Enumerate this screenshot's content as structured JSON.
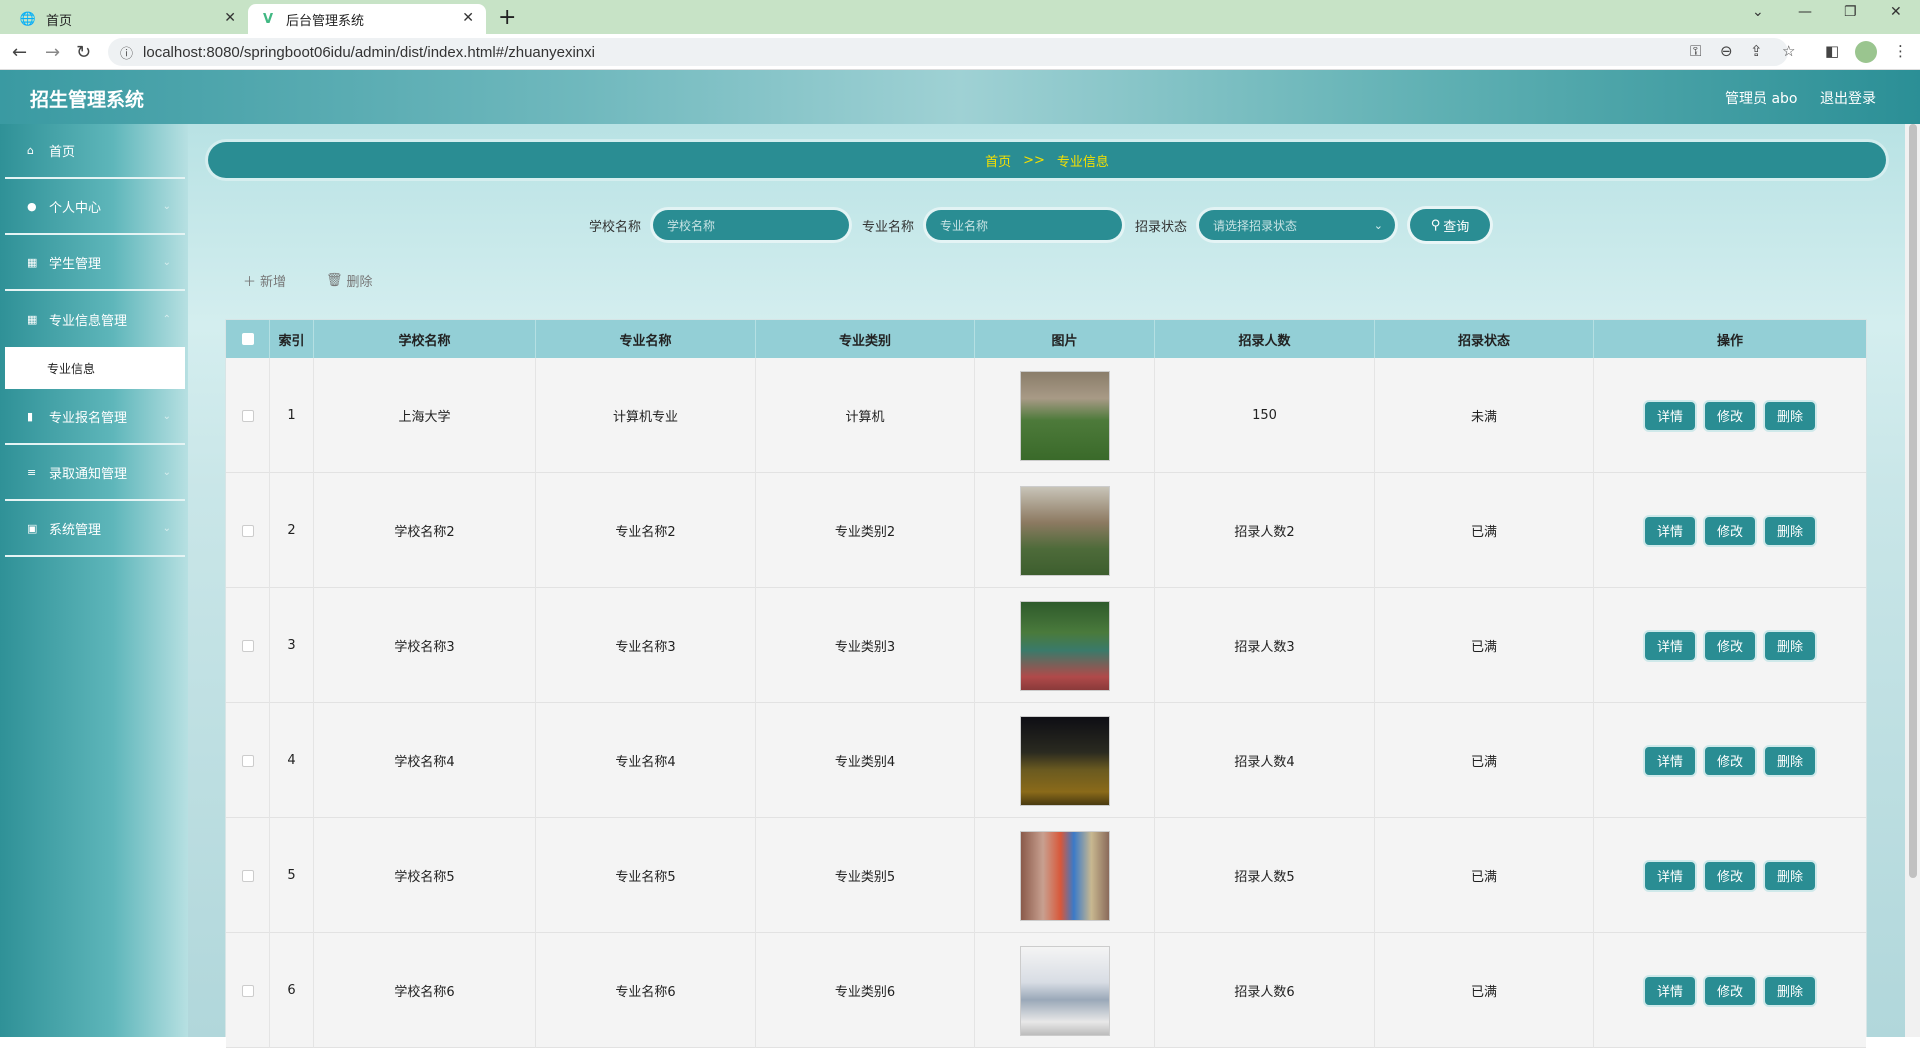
{
  "browser": {
    "tabs": [
      {
        "title": "首页",
        "icon": "globe-icon"
      },
      {
        "title": "后台管理系统",
        "icon": "vue-logo-icon"
      }
    ],
    "url": "localhost:8080/springboot06idu/admin/dist/index.html#/zhuanyexinxi"
  },
  "header": {
    "title": "招生管理系统",
    "user": "管理员 abo",
    "logout": "退出登录"
  },
  "sidebar": {
    "items": [
      {
        "label": "首页",
        "icon": "home-icon"
      },
      {
        "label": "个人中心",
        "icon": "user-icon"
      },
      {
        "label": "学生管理",
        "icon": "grid-icon"
      },
      {
        "label": "专业信息管理",
        "icon": "grid-icon"
      },
      {
        "label": "专业报名管理",
        "icon": "chart-icon"
      },
      {
        "label": "录取通知管理",
        "icon": "list-icon"
      },
      {
        "label": "系统管理",
        "icon": "briefcase-icon"
      }
    ],
    "active_sub": "专业信息"
  },
  "breadcrumb": {
    "home": "首页",
    "sep": ">>",
    "current": "专业信息"
  },
  "search": {
    "school_label": "学校名称",
    "school_placeholder": "学校名称",
    "major_label": "专业名称",
    "major_placeholder": "专业名称",
    "status_label": "招录状态",
    "status_placeholder": "请选择招录状态",
    "query_button": "查询"
  },
  "actions": {
    "add": "新增",
    "delete": "删除"
  },
  "table": {
    "columns": [
      "索引",
      "学校名称",
      "专业名称",
      "专业类别",
      "图片",
      "招录人数",
      "招录状态",
      "操作"
    ],
    "row_buttons": {
      "detail": "详情",
      "edit": "修改",
      "delete": "删除"
    },
    "rows": [
      {
        "index": "1",
        "school": "上海大学",
        "major": "计算机专业",
        "category": "计算机",
        "count": "150",
        "status": "未满",
        "image": "campus-building-photo"
      },
      {
        "index": "2",
        "school": "学校名称2",
        "major": "专业名称2",
        "category": "专业类别2",
        "count": "招录人数2",
        "status": "已满",
        "image": "campus-pavilion-photo"
      },
      {
        "index": "3",
        "school": "学校名称3",
        "major": "专业名称3",
        "category": "专业类别3",
        "count": "招录人数3",
        "status": "已满",
        "image": "basketball-court-photo"
      },
      {
        "index": "4",
        "school": "学校名称4",
        "major": "专业名称4",
        "category": "专业类别4",
        "count": "招录人数4",
        "status": "已满",
        "image": "night-field-photo"
      },
      {
        "index": "5",
        "school": "学校名称5",
        "major": "专业名称5",
        "category": "专业类别5",
        "count": "招录人数5",
        "status": "已满",
        "image": "sculpture-photo"
      },
      {
        "index": "6",
        "school": "学校名称6",
        "major": "专业名称6",
        "category": "专业类别6",
        "count": "招录人数6",
        "status": "已满",
        "image": "book-illustration-photo"
      }
    ]
  },
  "colors": {
    "accent": "#2a8d93",
    "header_col": "#93cfd6",
    "breadcrumb_text": "#f6e000"
  }
}
